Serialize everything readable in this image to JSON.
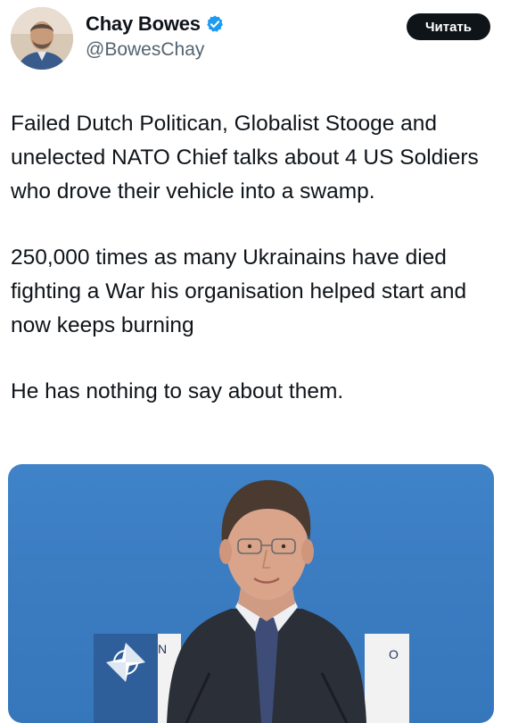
{
  "author": {
    "display_name": "Chay Bowes",
    "handle": "@BowesChay",
    "verified": true,
    "verified_color": "#1d9bf0",
    "avatar_icon": "person-portrait-avatar"
  },
  "header": {
    "read_button_label": "Читать"
  },
  "tweet": {
    "paragraphs": [
      "Failed Dutch Politican, Globalist Stooge and unelected NATO Chief talks about 4 US Soldiers who drove their vehicle into a swamp.",
      "250,000 times as many Ukrainains have died fighting a War his organisation helped start and now keeps burning",
      "He has nothing to say about them."
    ]
  },
  "media": {
    "panel_letters_left": "N",
    "panel_letters_right": "O",
    "background_color": "#3b7bc0"
  }
}
